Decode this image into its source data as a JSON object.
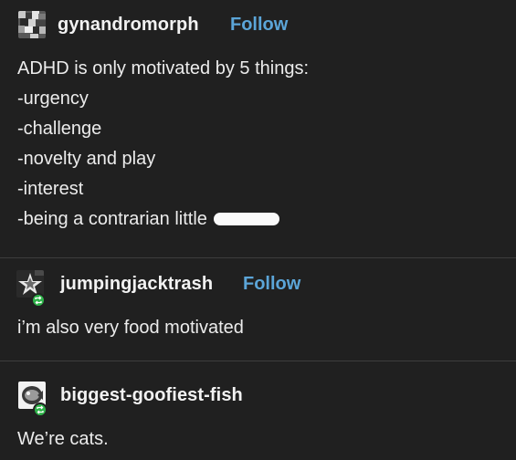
{
  "posts": [
    {
      "username": "gynandromorph",
      "follow_label": "Follow",
      "avatar_icon": "mosaic-avatar-icon",
      "lines": [
        "ADHD is only motivated by 5 things:",
        "-urgency",
        "-challenge",
        "-novelty and play",
        "-interest",
        "-being a contrarian little"
      ]
    },
    {
      "username": "jumpingjacktrash",
      "follow_label": "Follow",
      "avatar_icon": "star-avatar-icon",
      "reblog_icon": "reblog-icon",
      "text": "i’m also very food motivated"
    },
    {
      "username": "biggest-goofiest-fish",
      "avatar_icon": "fish-avatar-icon",
      "reblog_icon": "reblog-icon",
      "text": "We’re cats."
    }
  ],
  "colors": {
    "background": "#202020",
    "text": "#ececec",
    "follow": "#5ba5d8",
    "reblog_badge": "#2fb44a",
    "divider": "#3d3d3d"
  }
}
